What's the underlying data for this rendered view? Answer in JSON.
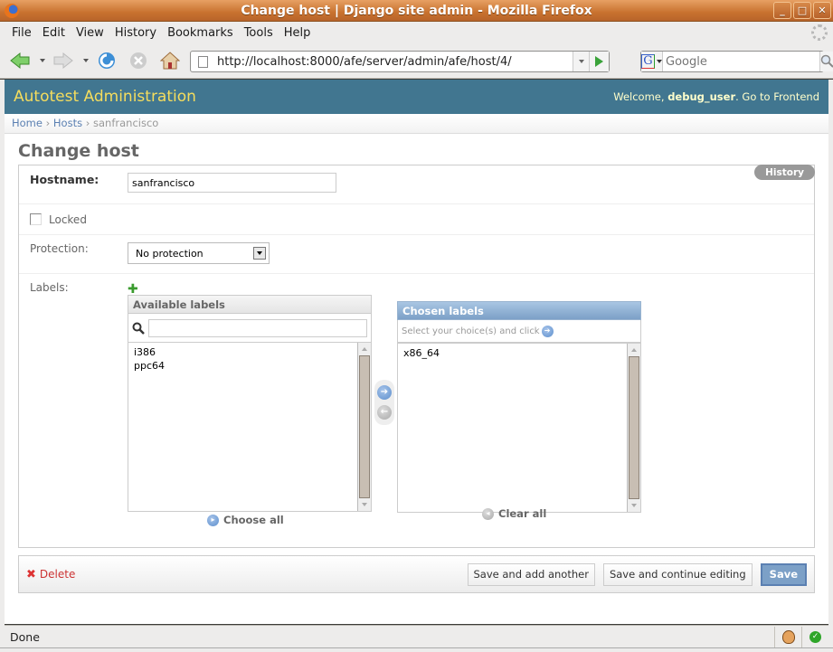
{
  "window": {
    "title": "Change host | Django site admin - Mozilla Firefox",
    "controls": [
      "minimize",
      "maximize",
      "close"
    ]
  },
  "menubar": {
    "items": [
      {
        "label": "File",
        "accel": "F"
      },
      {
        "label": "Edit",
        "accel": "E"
      },
      {
        "label": "View",
        "accel": "V"
      },
      {
        "label": "History",
        "accel": "s"
      },
      {
        "label": "Bookmarks",
        "accel": "B"
      },
      {
        "label": "Tools",
        "accel": "T"
      },
      {
        "label": "Help",
        "accel": "H"
      }
    ]
  },
  "navbar": {
    "url": "http://localhost:8000/afe/server/admin/afe/host/4/",
    "search_placeholder": "Google"
  },
  "header": {
    "branding": "Autotest Administration",
    "welcome_prefix": "Welcome, ",
    "username": "debug_user",
    "go_to_frontend": ". Go to Frontend"
  },
  "breadcrumbs": {
    "home": "Home",
    "hosts": "Hosts",
    "current": "sanfrancisco",
    "separator": "›"
  },
  "content": {
    "title": "Change host",
    "history_button": "History"
  },
  "form": {
    "hostname_label": "Hostname:",
    "hostname_value": "sanfrancisco",
    "locked_label": "Locked",
    "locked_checked": false,
    "protection_label": "Protection:",
    "protection_value": "No protection",
    "labels_label": "Labels:",
    "available_title": "Available labels",
    "available_items": [
      "i386",
      "ppc64"
    ],
    "chosen_title": "Chosen labels",
    "chosen_help": "Select your choice(s) and click",
    "chosen_items": [
      "x86_64"
    ],
    "choose_all": "Choose all",
    "clear_all": "Clear all"
  },
  "submit_row": {
    "delete": "Delete",
    "save_add_another": "Save and add another",
    "save_continue": "Save and continue editing",
    "save": "Save"
  },
  "statusbar": {
    "text": "Done"
  }
}
